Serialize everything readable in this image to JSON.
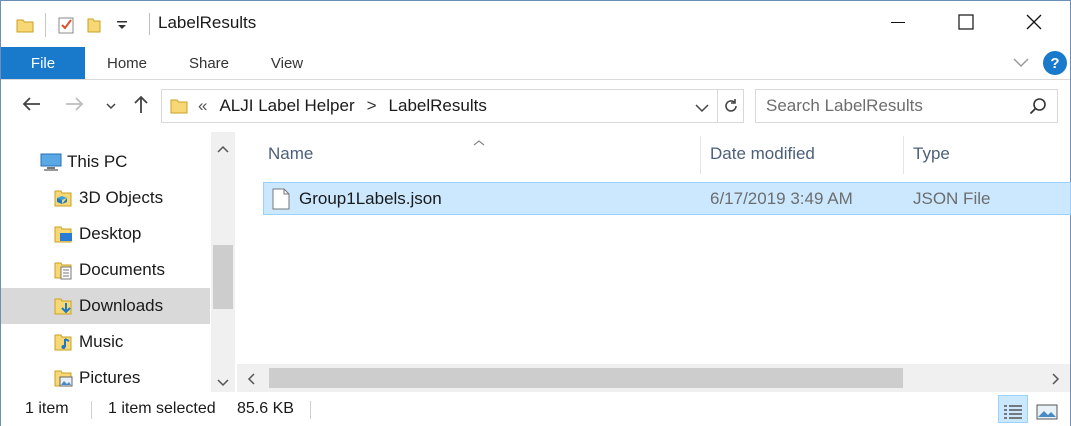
{
  "window": {
    "title": "LabelResults",
    "minimize_icon": "minimize-icon",
    "maximize_icon": "maximize-icon",
    "close_icon": "close-icon"
  },
  "quick_access": {
    "icons": [
      "folder-icon",
      "properties-checkmark-icon",
      "new-folder-icon",
      "customize-dropdown-icon"
    ]
  },
  "ribbon": {
    "tabs": [
      {
        "label": "File"
      },
      {
        "label": "Home"
      },
      {
        "label": "Share"
      },
      {
        "label": "View"
      }
    ]
  },
  "navigation": {
    "back_icon": "arrow-left-icon",
    "forward_icon": "arrow-right-icon",
    "recent_icon": "chevron-down-icon",
    "up_icon": "arrow-up-icon"
  },
  "address": {
    "overflow": "«",
    "crumbs": [
      "ALJI Label Helper",
      "LabelResults"
    ],
    "separator": ">"
  },
  "search": {
    "placeholder": "Search LabelResults"
  },
  "nav_pane": {
    "items": [
      {
        "label": "This PC",
        "icon": "computer-icon"
      },
      {
        "label": "3D Objects",
        "icon": "3d-objects-folder-icon"
      },
      {
        "label": "Desktop",
        "icon": "desktop-folder-icon"
      },
      {
        "label": "Documents",
        "icon": "documents-folder-icon"
      },
      {
        "label": "Downloads",
        "icon": "downloads-folder-icon",
        "selected": true
      },
      {
        "label": "Music",
        "icon": "music-folder-icon"
      },
      {
        "label": "Pictures",
        "icon": "pictures-folder-icon"
      }
    ]
  },
  "file_list": {
    "columns": [
      "Name",
      "Date modified",
      "Type"
    ],
    "sort_indicator": "sort-up-icon",
    "rows": [
      {
        "name": "Group1Labels.json",
        "date_modified": "6/17/2019 3:49 AM",
        "type": "JSON File",
        "icon": "file-icon",
        "selected": true
      }
    ]
  },
  "status_bar": {
    "item_count": "1 item",
    "selected": "1 item selected",
    "size": "85.6 KB"
  },
  "colors": {
    "file_tab": "#1979ca",
    "selection_fill": "#cce8ff",
    "selection_border": "#99d1ff",
    "folder": "#f8d775",
    "help": "#1979ca"
  }
}
